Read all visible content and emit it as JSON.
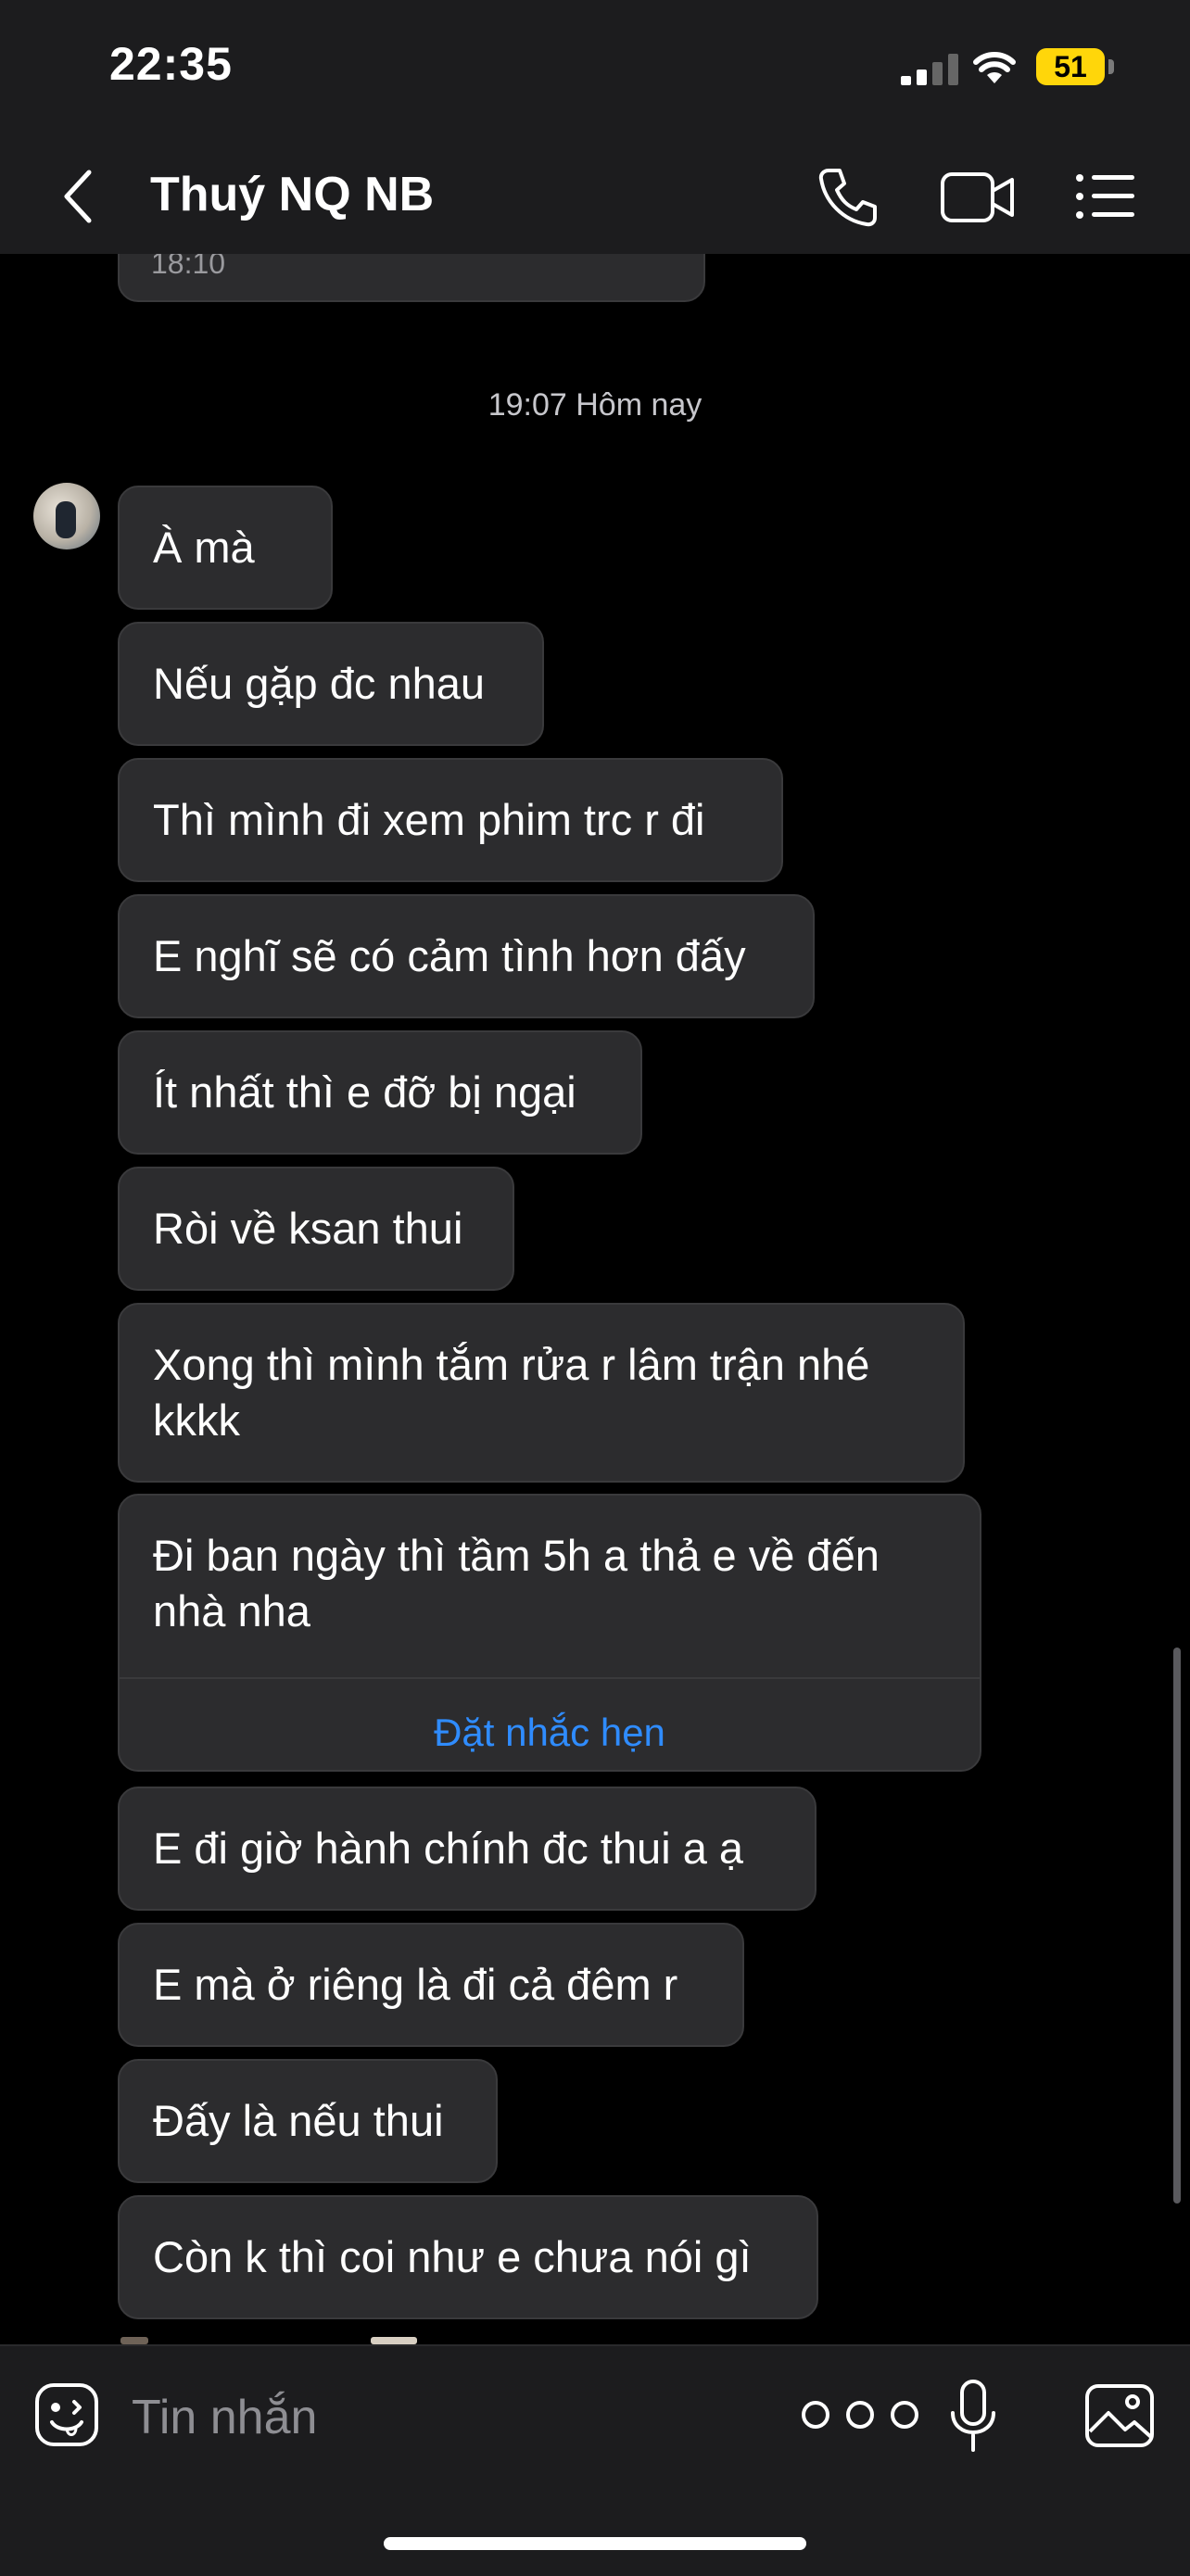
{
  "status_bar": {
    "time": "22:35",
    "battery": "51"
  },
  "header": {
    "contact_name": "Thuý NQ NB"
  },
  "chat": {
    "previous_time": "18:10",
    "date_separator": "19:07 Hôm nay",
    "messages": [
      {
        "text": "À mà"
      },
      {
        "text": "Nếu gặp đc nhau"
      },
      {
        "text": "Thì mình đi xem phim trc r đi"
      },
      {
        "text": "E nghĩ sẽ có cảm tình hơn đấy"
      },
      {
        "text": "Ít nhất thì e đỡ bị ngại"
      },
      {
        "text": "Ròi về ksan thui"
      },
      {
        "text_line1": "Xong thì mình tắm rửa r lâm trận nhé",
        "text_line2": "kkkk"
      },
      {
        "text_line1": "Đi ban ngày thì tầm 5h a thả e về đến",
        "text_line2": "nhà nha",
        "reminder_action": "Đặt nhắc hẹn"
      },
      {
        "text": "E đi giờ hành chính đc thui a ạ"
      },
      {
        "text": "E mà ở riêng là đi cả đêm r"
      },
      {
        "text": "Đấy là nếu thui"
      },
      {
        "text": "Còn k thì coi như e chưa nói gì"
      }
    ]
  },
  "composer": {
    "placeholder": "Tin nhắn"
  },
  "colors": {
    "bubble": "#2c2c2e",
    "accent": "#2f8cff",
    "battery": "#ffd60a"
  },
  "icons": [
    "back-icon",
    "phone-icon",
    "video-camera-icon",
    "list-menu-icon",
    "emoji-icon",
    "more-icon",
    "microphone-icon",
    "image-icon"
  ]
}
